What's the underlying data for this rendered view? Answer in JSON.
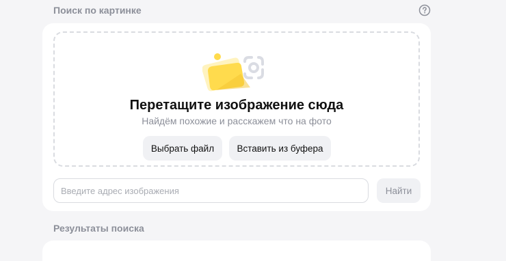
{
  "header": {
    "title": "Поиск по картинке",
    "help_icon": "question-circle-icon"
  },
  "dropzone": {
    "title": "Перетащите изображение сюда",
    "subtitle": "Найдём похожие и расскажем что на фото",
    "choose_file_label": "Выбрать файл",
    "paste_label": "Вставить из буфера",
    "illustration_icon": "image-placeholder-icon"
  },
  "url_search": {
    "placeholder": "Введите адрес изображения",
    "value": "",
    "find_label": "Найти"
  },
  "results": {
    "title": "Результаты поиска"
  },
  "colors": {
    "accent_yellow": "#ffdb4d",
    "muted_text": "#8c8f99",
    "dashed_border": "#d9dbe0"
  }
}
